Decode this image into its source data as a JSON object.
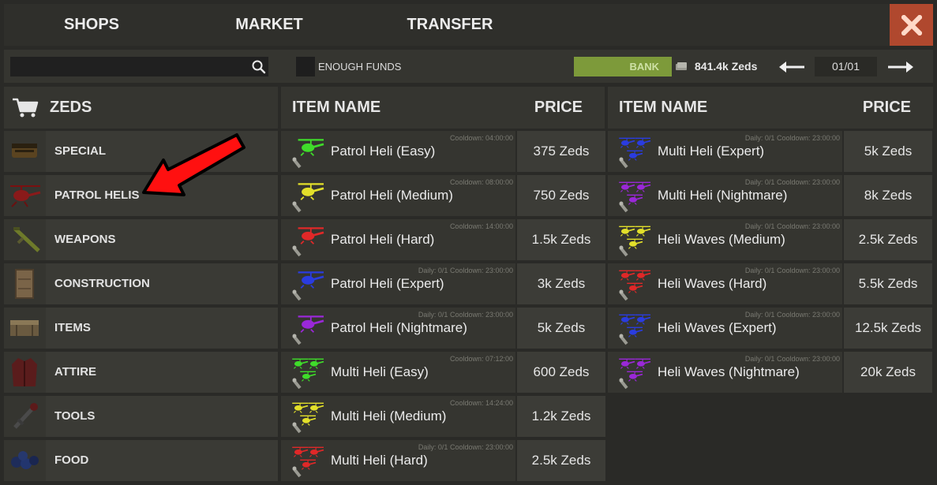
{
  "tabs": [
    {
      "label": "SHOPS"
    },
    {
      "label": "MARKET"
    },
    {
      "label": "TRANSFER"
    }
  ],
  "close_icon": "close-x-icon",
  "search": {
    "value": "",
    "placeholder": ""
  },
  "filter": {
    "enough_funds_label": "ENOUGH FUNDS",
    "checked": false
  },
  "bank": {
    "label": "BANK",
    "balance": "841.4k Zeds"
  },
  "pager": {
    "value": "01/01"
  },
  "colors": {
    "accent_close": "#b0482e",
    "bank_green": "#7d9a3a",
    "panel": "#353530",
    "bg": "#2a2a27"
  },
  "categories": {
    "title": "ZEDS",
    "items": [
      {
        "label": "SPECIAL",
        "icon": "crate-icon"
      },
      {
        "label": "PATROL HELIS",
        "icon": "helicopter-icon"
      },
      {
        "label": "WEAPONS",
        "icon": "rifle-icon"
      },
      {
        "label": "CONSTRUCTION",
        "icon": "wood-door-icon"
      },
      {
        "label": "ITEMS",
        "icon": "box-icon"
      },
      {
        "label": "ATTIRE",
        "icon": "jacket-icon"
      },
      {
        "label": "TOOLS",
        "icon": "tool-icon"
      },
      {
        "label": "FOOD",
        "icon": "berries-icon"
      }
    ]
  },
  "columns": [
    {
      "name_header": "ITEM NAME",
      "price_header": "PRICE",
      "items": [
        {
          "name": "Patrol Heli (Easy)",
          "price": "375 Zeds",
          "cooldown": "Cooldown: 04:00:00",
          "color": "#3fdc2a"
        },
        {
          "name": "Patrol Heli (Medium)",
          "price": "750 Zeds",
          "cooldown": "Cooldown: 08:00:00",
          "color": "#e3e02a"
        },
        {
          "name": "Patrol Heli (Hard)",
          "price": "1.5k Zeds",
          "cooldown": "Cooldown: 14:00:00",
          "color": "#e02828"
        },
        {
          "name": "Patrol Heli (Expert)",
          "price": "3k Zeds",
          "cooldown": "Daily: 0/1 Cooldown: 23:00:00",
          "color": "#2a3ce0"
        },
        {
          "name": "Patrol Heli (Nightmare)",
          "price": "5k Zeds",
          "cooldown": "Daily: 0/1 Cooldown: 23:00:00",
          "color": "#9a28d8"
        },
        {
          "name": "Multi Heli (Easy)",
          "price": "600 Zeds",
          "cooldown": "Cooldown: 07:12:00",
          "color": "#3fdc2a"
        },
        {
          "name": "Multi Heli (Medium)",
          "price": "1.2k Zeds",
          "cooldown": "Cooldown: 14:24:00",
          "color": "#e3e02a"
        },
        {
          "name": "Multi Heli (Hard)",
          "price": "2.5k Zeds",
          "cooldown": "Daily: 0/1 Cooldown: 23:00:00",
          "color": "#e02828"
        }
      ]
    },
    {
      "name_header": "ITEM NAME",
      "price_header": "PRICE",
      "items": [
        {
          "name": "Multi Heli (Expert)",
          "price": "5k Zeds",
          "cooldown": "Daily: 0/1 Cooldown: 23:00:00",
          "color": "#2a3ce0"
        },
        {
          "name": "Multi Heli (Nightmare)",
          "price": "8k Zeds",
          "cooldown": "Daily: 0/1 Cooldown: 23:00:00",
          "color": "#9a28d8"
        },
        {
          "name": "Heli Waves (Medium)",
          "price": "2.5k Zeds",
          "cooldown": "Daily: 0/1 Cooldown: 23:00:00",
          "color": "#e3e02a"
        },
        {
          "name": "Heli Waves (Hard)",
          "price": "5.5k Zeds",
          "cooldown": "Daily: 0/1 Cooldown: 23:00:00",
          "color": "#e02828"
        },
        {
          "name": "Heli Waves (Expert)",
          "price": "12.5k Zeds",
          "cooldown": "Daily: 0/1 Cooldown: 23:00:00",
          "color": "#2a3ce0"
        },
        {
          "name": "Heli Waves (Nightmare)",
          "price": "20k Zeds",
          "cooldown": "Daily: 0/1 Cooldown: 23:00:00",
          "color": "#9a28d8"
        }
      ]
    }
  ]
}
